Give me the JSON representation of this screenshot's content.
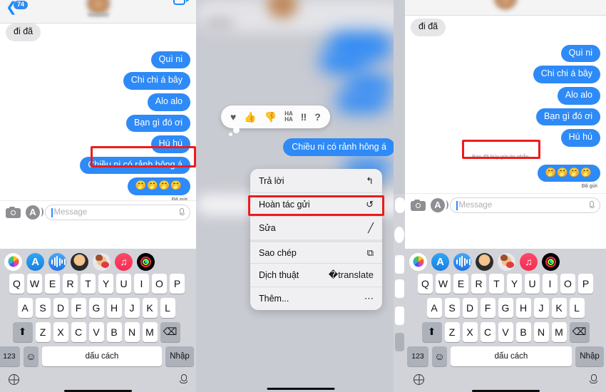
{
  "meta": {
    "app": "Messages",
    "language": "vi-VN",
    "accent_blue": "#2e8af7",
    "annotation_red": "#ee1b1b",
    "keyboard_bg": "#d1d3d9",
    "bubble_in_bg": "#e6e6e8"
  },
  "header": {
    "back_icon": "chevron-left-icon",
    "unread_badge": "74",
    "avatar": "blurred-contact-avatar",
    "video_icon": "video-camera-icon"
  },
  "thread": {
    "messages": [
      {
        "side": "in",
        "text": "đi đã"
      },
      {
        "side": "out",
        "text": "Quì ni"
      },
      {
        "side": "out",
        "text": "Chi chi á bây"
      },
      {
        "side": "out",
        "text": "Alo alo"
      },
      {
        "side": "out",
        "text": "Bạn gì đó ơi"
      },
      {
        "side": "out",
        "text": "Hú hú"
      },
      {
        "side": "out",
        "text": "Chiều ni có rảnh hông á",
        "highlighted": true
      },
      {
        "side": "out",
        "text": "🤭🤭🤭🤭",
        "emoji": true
      }
    ],
    "sent_label": "Đã gửi",
    "unsent_note": "Bạn đã hủy gửi tin nhắn"
  },
  "input_bar": {
    "camera_icon": "camera-icon",
    "appstore_icon": "app-store-icon",
    "placeholder": "Message",
    "mic_icon": "microphone-icon"
  },
  "app_strip": {
    "items": [
      {
        "name": "photos-app-icon",
        "label": "Photos"
      },
      {
        "name": "app-store-app-icon",
        "label": "App Store"
      },
      {
        "name": "digital-touch-app-icon",
        "label": "Digital Touch"
      },
      {
        "name": "memoji-app-icon",
        "label": "Memoji"
      },
      {
        "name": "memoji-stickers-app-icon",
        "label": "Memoji Stickers"
      },
      {
        "name": "music-app-icon",
        "label": "Music"
      },
      {
        "name": "fitness-app-icon",
        "label": "Fitness"
      }
    ]
  },
  "keyboard": {
    "row1": [
      "Q",
      "W",
      "E",
      "R",
      "T",
      "Y",
      "U",
      "I",
      "O",
      "P"
    ],
    "row2": [
      "A",
      "S",
      "D",
      "F",
      "G",
      "H",
      "J",
      "K",
      "L"
    ],
    "row3": [
      "Z",
      "X",
      "C",
      "V",
      "B",
      "N",
      "M"
    ],
    "shift_icon": "shift-up-arrow-icon",
    "backspace_icon": "backspace-delete-icon",
    "numeric_key": "123",
    "emoji_key": "emoji-smiley-icon",
    "space_key": "dấu cách",
    "return_key": "Nhập",
    "globe_icon": "globe-language-icon",
    "dictation_icon": "microphone-dictation-icon",
    "home_indicator": "home-indicator-bar"
  },
  "reaction_bar": {
    "items": [
      {
        "name": "heart-reaction-icon",
        "glyph": "♥"
      },
      {
        "name": "thumbs-up-reaction-icon",
        "glyph": "👍"
      },
      {
        "name": "thumbs-down-reaction-icon",
        "glyph": "👎"
      },
      {
        "name": "haha-reaction-icon",
        "glyph": "HA\nHA"
      },
      {
        "name": "exclamation-reaction-icon",
        "glyph": "‼"
      },
      {
        "name": "question-reaction-icon",
        "glyph": "?"
      }
    ],
    "haha_line1": "HA",
    "haha_line2": "HA"
  },
  "context_menu": {
    "focused_message": "Chiều ni có rảnh hông á",
    "items": [
      {
        "label": "Trả lời",
        "icon": "reply-arrow-icon",
        "glyph": "↰",
        "highlighted": false
      },
      {
        "label": "Hoàn tác gửi",
        "icon": "undo-send-icon",
        "glyph": "↺",
        "highlighted": true
      },
      {
        "label": "Sửa",
        "icon": "edit-pencil-icon",
        "glyph": "╱",
        "highlighted": false
      },
      {
        "label": "Sao chép",
        "icon": "copy-duplicate-icon",
        "glyph": "⧉",
        "highlighted": false
      },
      {
        "label": "Dịch thuật",
        "icon": "translate-icon",
        "glyph": "⌘",
        "highlighted": false
      },
      {
        "label": "Thêm...",
        "icon": "more-ellipsis-circle-icon",
        "glyph": "⋯",
        "highlighted": false
      }
    ]
  }
}
